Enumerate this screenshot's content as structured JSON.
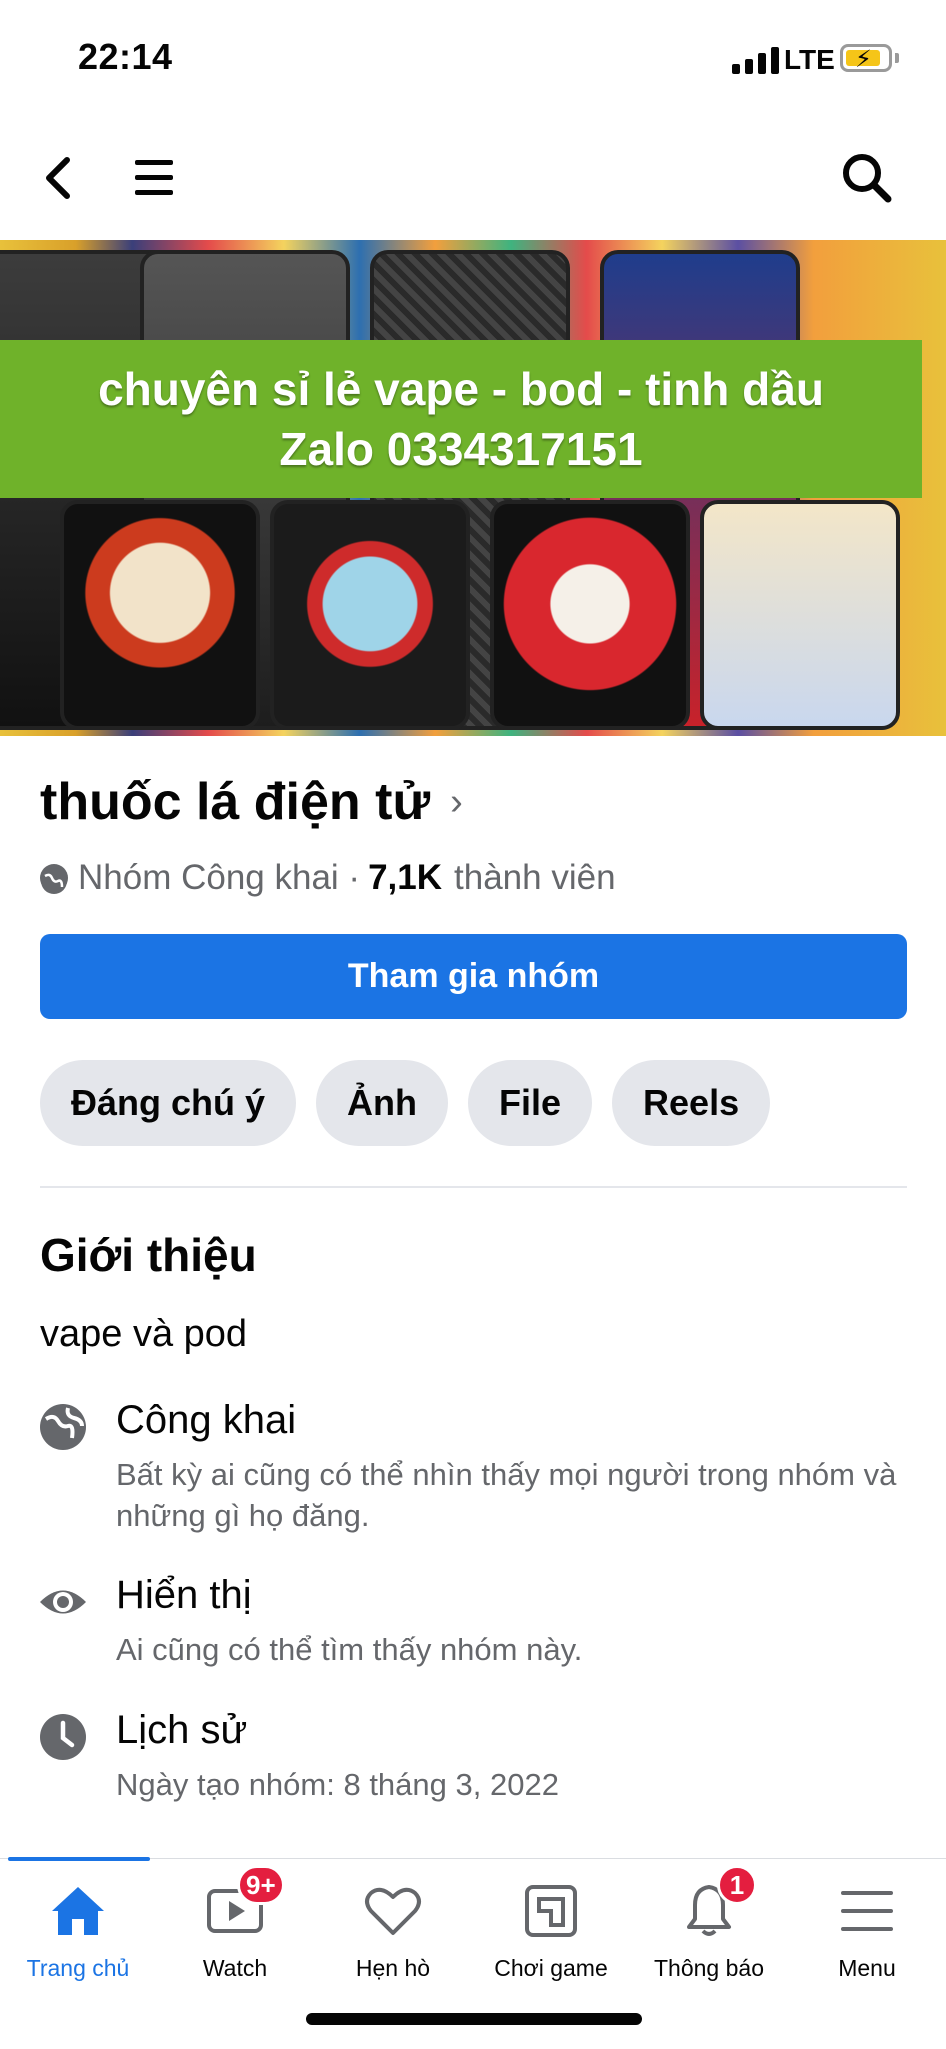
{
  "status": {
    "time": "22:14",
    "network": "LTE"
  },
  "cover": {
    "line1": "chuyên sỉ lẻ vape - bod - tinh dầu",
    "line2": "Zalo 0334317151"
  },
  "group": {
    "name": "thuốc lá điện tử",
    "privacy": "Nhóm Công khai ·",
    "member_count": "7,1K",
    "member_label": "thành viên",
    "join_label": "Tham gia nhóm"
  },
  "chips": [
    "Đáng chú ý",
    "Ảnh",
    "File",
    "Reels"
  ],
  "about": {
    "title": "Giới thiệu",
    "description": "vape và pod",
    "items": [
      {
        "label": "Công khai",
        "sub": "Bất kỳ ai cũng có thể nhìn thấy mọi người trong nhóm và những gì họ đăng.",
        "icon": "globe-icon"
      },
      {
        "label": "Hiển thị",
        "sub": "Ai cũng có thể tìm thấy nhóm này.",
        "icon": "eye-icon"
      },
      {
        "label": "Lịch sử",
        "sub": "Ngày tạo nhóm: 8 tháng 3, 2022",
        "icon": "clock-icon"
      }
    ]
  },
  "tabs": [
    {
      "label": "Trang chủ",
      "icon": "home-icon",
      "active": true
    },
    {
      "label": "Watch",
      "icon": "watch-icon",
      "badge": "9+"
    },
    {
      "label": "Hẹn hò",
      "icon": "heart-icon"
    },
    {
      "label": "Chơi game",
      "icon": "game-icon"
    },
    {
      "label": "Thông báo",
      "icon": "bell-icon",
      "badge": "1"
    },
    {
      "label": "Menu",
      "icon": "menu-icon"
    }
  ],
  "colors": {
    "accent": "#1b74e4",
    "badge": "#e41e3f",
    "banner": "#6fb22a"
  }
}
